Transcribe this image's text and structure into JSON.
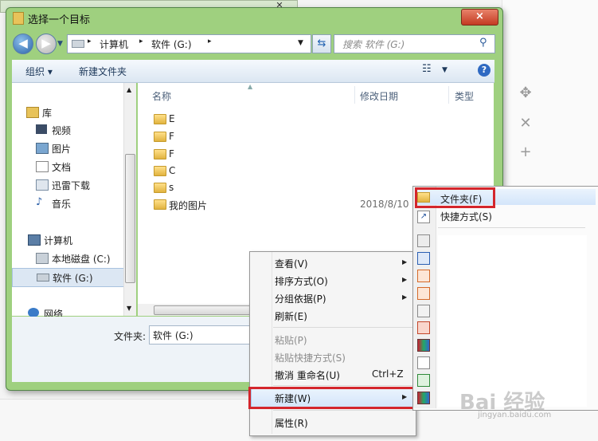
{
  "dialog": {
    "title": "选择一个目标",
    "close_label": "×"
  },
  "address": {
    "crumbs": [
      "计算机",
      "软件 (G:)"
    ],
    "separator": "▸"
  },
  "search": {
    "placeholder": "搜索 软件 (G:)"
  },
  "toolbar": {
    "organize": "组织 ▾",
    "new_folder": "新建文件夹",
    "help": "?"
  },
  "nav": {
    "libraries": "库",
    "items": [
      "视频",
      "图片",
      "文档",
      "迅雷下载",
      "音乐"
    ],
    "computer": "计算机",
    "drives": [
      "本地磁盘 (C:)",
      "软件 (G:)"
    ],
    "network": "网络"
  },
  "columns": {
    "name": "名称",
    "date": "修改日期",
    "type": "类型"
  },
  "files": [
    {
      "name": "E",
      "date": "",
      "type": ""
    },
    {
      "name": "F",
      "date": "",
      "type": ""
    },
    {
      "name": "F",
      "date": "",
      "type": ""
    },
    {
      "name": "C",
      "date": "",
      "type": ""
    },
    {
      "name": "s",
      "date": "",
      "type": ""
    },
    {
      "name": "我的图片",
      "date": "2018/8/10",
      "type": ""
    }
  ],
  "footer": {
    "folder_label": "文件夹:",
    "folder_value": "软件 (G:)"
  },
  "context_menu": {
    "items": [
      {
        "label": "查看(V)",
        "submenu": true
      },
      {
        "label": "排序方式(O)",
        "submenu": true
      },
      {
        "label": "分组依据(P)",
        "submenu": true
      },
      {
        "label": "刷新(E)"
      },
      {
        "label": "粘贴(P)",
        "disabled": true
      },
      {
        "label": "粘贴快捷方式(S)",
        "disabled": true
      },
      {
        "label": "撤消 重命名(U)",
        "shortcut": "Ctrl+Z"
      },
      {
        "label": "新建(W)",
        "submenu": true,
        "highlighted": true
      },
      {
        "label": "属性(R)"
      }
    ]
  },
  "submenu": {
    "items": [
      {
        "label": "文件夹(F)",
        "icon": "folder-icon",
        "highlighted": true
      },
      {
        "label": "快捷方式(S)",
        "icon": "shortcut-icon"
      }
    ]
  },
  "right_tools": [
    "move-icon",
    "close-icon",
    "plus-icon"
  ],
  "watermark": {
    "brand": "Bai 经验",
    "url": "jingyan.baidu.com"
  },
  "colors": {
    "window_frame": "#9fd07f",
    "highlight_box": "#d4262c",
    "selection": "#d3e5fa"
  }
}
